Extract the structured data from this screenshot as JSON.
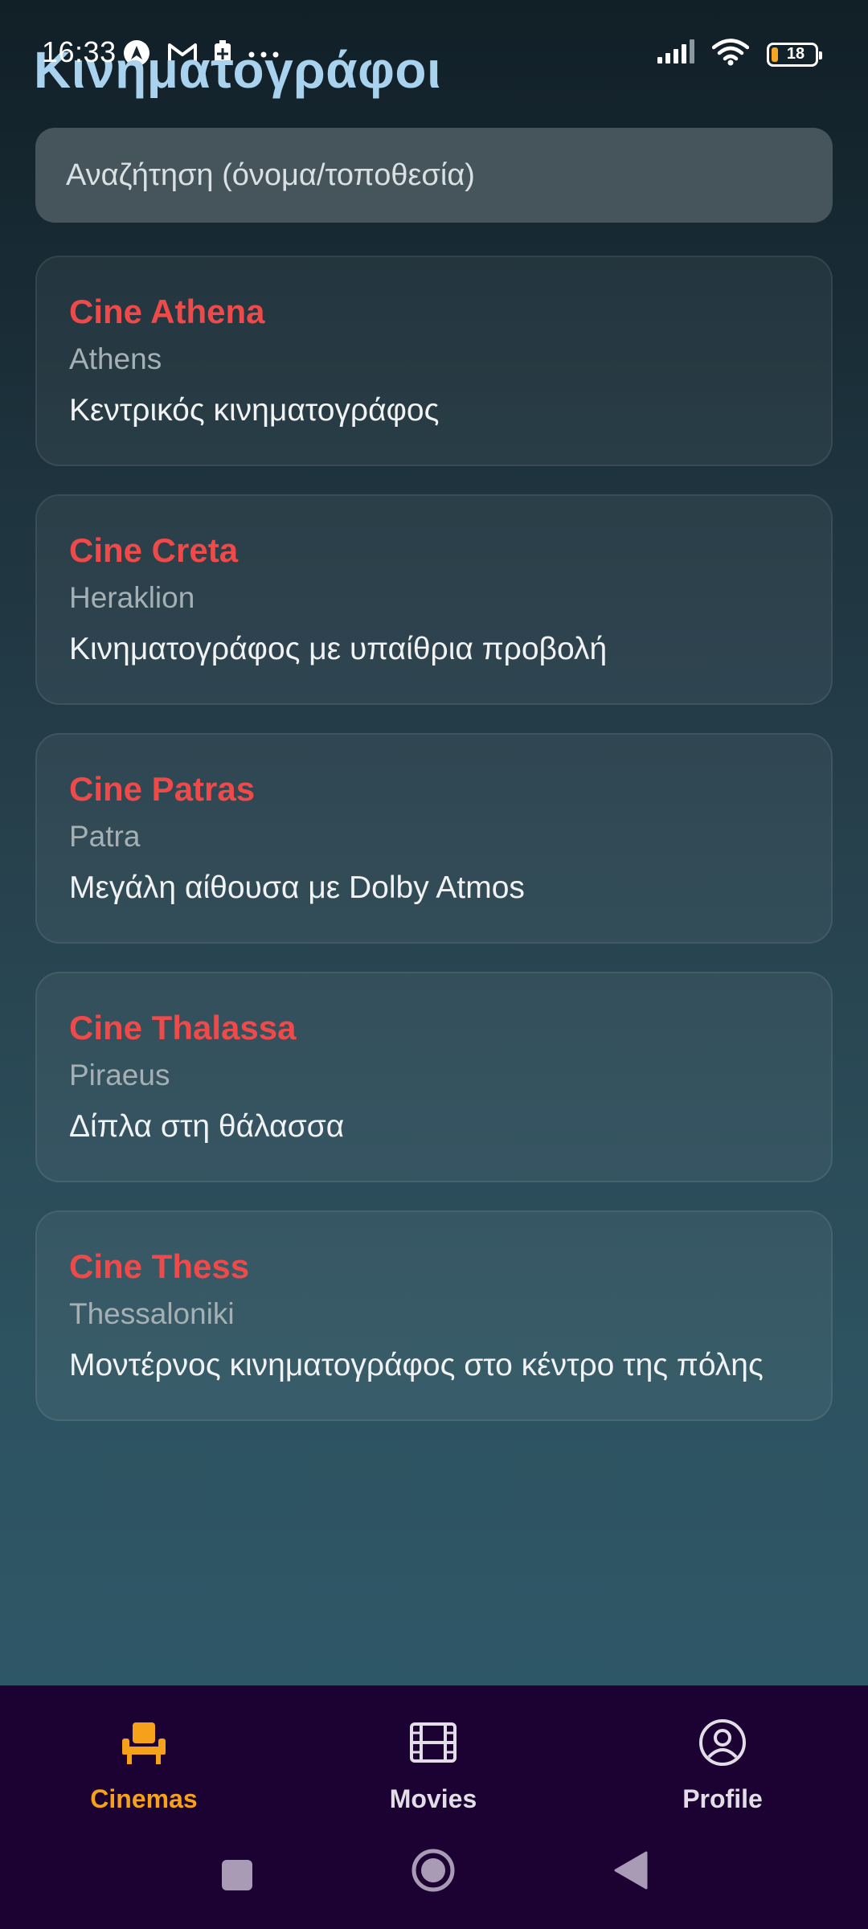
{
  "status_bar": {
    "time": "16:33",
    "battery_level": "18",
    "icons": [
      "navigation-a-icon",
      "gmail-icon",
      "battery-saver-icon",
      "more-dots-icon",
      "signal-icon",
      "wifi-icon",
      "battery-icon"
    ]
  },
  "header": {
    "title": "Κινηματογράφοι"
  },
  "search": {
    "placeholder": "Αναζήτηση (όνομα/τοποθεσία)",
    "value": ""
  },
  "cinemas": [
    {
      "name": "Cine Athena",
      "city": "Athens",
      "description": "Κεντρικός κινηματογράφος"
    },
    {
      "name": "Cine Creta",
      "city": "Heraklion",
      "description": "Κινηματογράφος με υπαίθρια προβολή"
    },
    {
      "name": "Cine Patras",
      "city": "Patra",
      "description": "Μεγάλη αίθουσα με Dolby Atmos"
    },
    {
      "name": "Cine Thalassa",
      "city": "Piraeus",
      "description": "Δίπλα στη θάλασσα"
    },
    {
      "name": "Cine Thess",
      "city": "Thessaloniki",
      "description": "Μοντέρνος κινηματογράφος στο κέντρο της πόλης"
    }
  ],
  "bottom_nav": {
    "items": [
      {
        "label": "Cinemas",
        "icon": "seat-icon",
        "active": true
      },
      {
        "label": "Movies",
        "icon": "film-icon",
        "active": false
      },
      {
        "label": "Profile",
        "icon": "profile-icon",
        "active": false
      }
    ]
  },
  "colors": {
    "accent_active": "#f5a21a",
    "cinema_name": "#ef4a4a",
    "title": "#a9d2ee",
    "nav_background": "#1c0232"
  }
}
